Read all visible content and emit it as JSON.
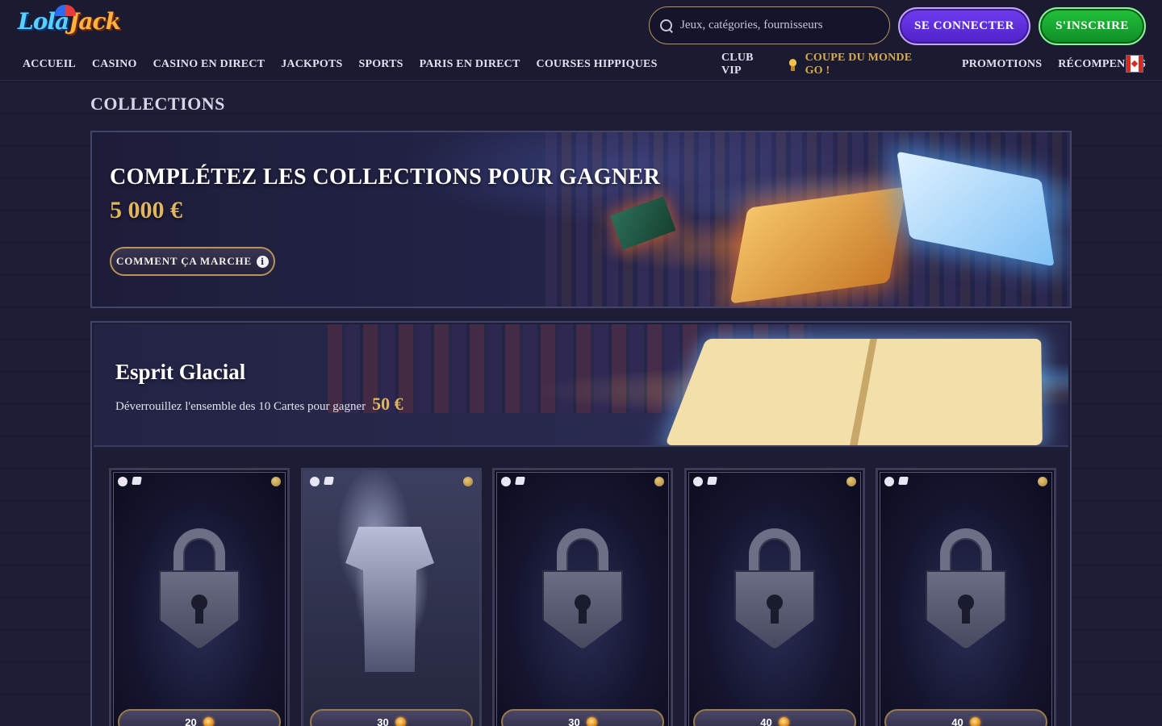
{
  "brand": {
    "logo_part1": "Lola",
    "logo_part2": "Jack"
  },
  "header": {
    "search_placeholder": "Jeux, catégories, fournisseurs",
    "login_label": "SE CONNECTER",
    "signup_label": "S'INSCRIRE",
    "nav_left": [
      "ACCUEIL",
      "CASINO",
      "CASINO EN DIRECT",
      "JACKPOTS",
      "SPORTS",
      "PARIS EN DIRECT",
      "COURSES HIPPIQUES"
    ],
    "nav_right": {
      "vip": "CLUB VIP",
      "worldcup": "COUPE DU MONDE GO !",
      "promotions": "PROMOTIONS",
      "rewards": "RÉCOMPENSES"
    },
    "country_flag": "canada-flag-icon"
  },
  "page": {
    "title": "COLLECTIONS"
  },
  "hero": {
    "title": "COMPLÉTEZ LES COLLECTIONS POUR GAGNER",
    "amount": "5 000 €",
    "button_label": "COMMENT ÇA MARCHE"
  },
  "collection": {
    "name": "Esprit Glacial",
    "description": "Déverrouillez l'ensemble des 10 Cartes pour gagner",
    "reward": "50 €",
    "cards": [
      {
        "state": "locked",
        "price": "20"
      },
      {
        "state": "unlocked",
        "price": "30"
      },
      {
        "state": "locked",
        "price": "30"
      },
      {
        "state": "locked",
        "price": "40"
      },
      {
        "state": "locked",
        "price": "40"
      }
    ]
  },
  "colors": {
    "background": "#1c1c35",
    "gold": "#e0b560",
    "login_purple": "#6f3cf0",
    "signup_green": "#22c23a"
  }
}
